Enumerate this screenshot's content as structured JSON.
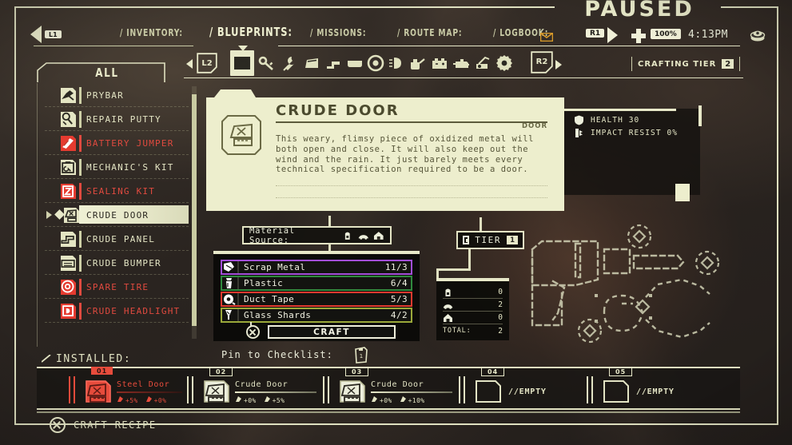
{
  "status": {
    "paused_text": "PAUSED",
    "clock": "4:13PM",
    "health_percent": "100%"
  },
  "buttons": {
    "l1": "L1",
    "l2": "L2",
    "r1": "R1",
    "r2": "R2"
  },
  "nav": {
    "tabs": [
      {
        "label": "/ INVENTORY:",
        "active": false
      },
      {
        "label": "/ BLUEPRINTS:",
        "active": true
      },
      {
        "label": "/ MISSIONS:",
        "active": false
      },
      {
        "label": "/ ROUTE MAP:",
        "active": false
      },
      {
        "label": "/ LOGBOOK:",
        "active": false
      }
    ]
  },
  "crafting_tier": {
    "label": "CRAFTING TIER",
    "value": "2"
  },
  "categories": {
    "selected_index": 0,
    "items": [
      {
        "icon": "car-icon"
      },
      {
        "icon": "key-icon"
      },
      {
        "icon": "wrench-icon"
      },
      {
        "icon": "door-icon"
      },
      {
        "icon": "panel-icon"
      },
      {
        "icon": "bumper-icon"
      },
      {
        "icon": "tire-icon"
      },
      {
        "icon": "headlight-icon"
      },
      {
        "icon": "oilcan-icon"
      },
      {
        "icon": "battery-icon"
      },
      {
        "icon": "engine-icon"
      },
      {
        "icon": "winch-icon"
      },
      {
        "icon": "gear-icon"
      }
    ]
  },
  "sidebar": {
    "filter_label": "ALL",
    "items": [
      {
        "label": "PRYBAR",
        "state": "normal"
      },
      {
        "label": "REPAIR PUTTY",
        "state": "normal"
      },
      {
        "label": "BATTERY JUMPER",
        "state": "locked"
      },
      {
        "label": "MECHANIC'S KIT",
        "state": "normal"
      },
      {
        "label": "SEALING KIT",
        "state": "locked"
      },
      {
        "label": "CRUDE DOOR",
        "state": "selected"
      },
      {
        "label": "CRUDE PANEL",
        "state": "normal"
      },
      {
        "label": "CRUDE BUMPER",
        "state": "normal"
      },
      {
        "label": "SPARE TIRE",
        "state": "locked"
      },
      {
        "label": "CRUDE HEADLIGHT",
        "state": "locked"
      }
    ]
  },
  "detail": {
    "title": "CRUDE DOOR",
    "type": "DOOR",
    "description": "This weary, flimsy piece of oxidized metal will both open and close. It will also keep out the wind and the rain. It just barely meets every technical specification required to be a door.",
    "stats": [
      {
        "icon": "shield-icon",
        "text": "HEALTH  30"
      },
      {
        "icon": "impact-icon",
        "text": "IMPACT RESIST 0%"
      }
    ]
  },
  "material_source": {
    "label": "Material Source:",
    "icons": [
      "backpack-icon",
      "car-icon",
      "home-icon"
    ]
  },
  "materials": {
    "rows": [
      {
        "name": "Scrap Metal",
        "qty": "11/3",
        "color": "#a24ed6",
        "icon": "scrap-icon"
      },
      {
        "name": "Plastic",
        "qty": "6/4",
        "color": "#2f8a3e",
        "icon": "plastic-icon"
      },
      {
        "name": "Duct Tape",
        "qty": "5/3",
        "color": "#e03a2f",
        "icon": "ducttape-icon"
      },
      {
        "name": "Glass Shards",
        "qty": "4/2",
        "color": "#9aa83a",
        "icon": "glass-icon"
      }
    ],
    "craft_label": "CRAFT"
  },
  "tier": {
    "label": "TIER",
    "value": "1"
  },
  "totals": {
    "rows": [
      {
        "icon": "backpack-icon",
        "label": "",
        "value": "0"
      },
      {
        "icon": "car-icon",
        "label": "",
        "value": "2"
      },
      {
        "icon": "home-icon",
        "label": "",
        "value": "0"
      }
    ],
    "total_label": "TOTAL:",
    "total_value": "2"
  },
  "installed": {
    "header": "INSTALLED:",
    "pin_label": "Pin to Checklist:",
    "slots": [
      {
        "num": "01",
        "name": "Steel Door",
        "state": "filled",
        "stats": [
          "+5%",
          "+0%"
        ],
        "empty_label": ""
      },
      {
        "num": "02",
        "name": "Crude Door",
        "state": "normal",
        "stats": [
          "+0%",
          "+5%"
        ],
        "empty_label": ""
      },
      {
        "num": "03",
        "name": "Crude Door",
        "state": "normal",
        "stats": [
          "+0%",
          "+10%"
        ],
        "empty_label": ""
      },
      {
        "num": "04",
        "name": "",
        "state": "empty",
        "stats": [],
        "empty_label": "//EMPTY"
      },
      {
        "num": "05",
        "name": "",
        "state": "empty",
        "stats": [],
        "empty_label": "//EMPTY"
      }
    ]
  },
  "footer": {
    "action_label": "CRAFT RECIPE"
  },
  "colors": {
    "cream": "#e8e9c9",
    "locked_red": "#e04a3f",
    "dark": "#1a1815"
  }
}
